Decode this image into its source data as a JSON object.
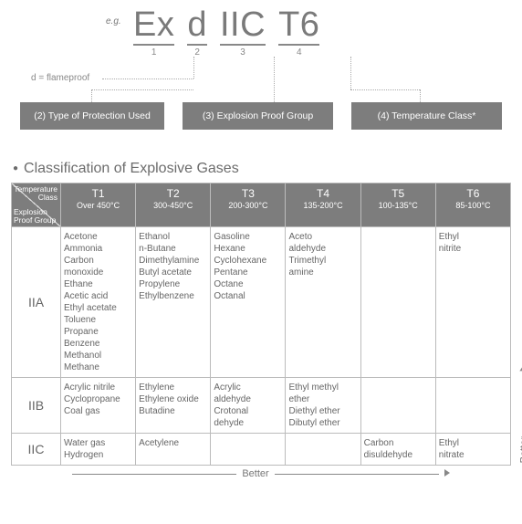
{
  "header": {
    "eg": "e.g.",
    "segments": [
      {
        "text": "Ex",
        "num": "1"
      },
      {
        "text": "d",
        "num": "2"
      },
      {
        "text": "IIC",
        "num": "3"
      },
      {
        "text": "T6",
        "num": "4"
      }
    ],
    "flameproof": "d = flameproof",
    "boxes": [
      "(2) Type of Protection Used",
      "(3) Explosion Proof Group",
      "(4) Temperature Class*"
    ]
  },
  "section_title": "Classification of Explosive Gases",
  "table": {
    "diag": {
      "top": "Temperature\nClass",
      "bottom": "Explosion\nProof  Group"
    },
    "columns": [
      {
        "code": "T1",
        "range": "Over 450°C"
      },
      {
        "code": "T2",
        "range": "300-450°C"
      },
      {
        "code": "T3",
        "range": "200-300°C"
      },
      {
        "code": "T4",
        "range": "135-200°C"
      },
      {
        "code": "T5",
        "range": "100-135°C"
      },
      {
        "code": "T6",
        "range": "85-100°C"
      }
    ],
    "rows": [
      {
        "group": "IIA",
        "cells": [
          "Acetone\nAmmonia\nCarbon\n   monoxide\nEthane\nAcetic acid\nEthyl acetate\nToluene\nPropane\nBenzene\nMethanol\nMethane",
          "Ethanol\nn-Butane\nDimethylamine\nButyl acetate\nPropylene\nEthylbenzene",
          "Gasoline\nHexane\nCyclohexane\nPentane\nOctane\nOctanal",
          "Aceto\n  aldehyde\nTrimethyl\n  amine",
          "",
          "Ethyl\n  nitrite"
        ]
      },
      {
        "group": "IIB",
        "cells": [
          "Acrylic nitrile\nCyclopropane\nCoal gas",
          "Ethylene\nEthylene oxide\nButadine",
          "Acrylic\n  aldehyde\nCrotonal\n  dehyde",
          "Ethyl methyl\n  ether\nDiethyl ether\nDibutyl ether",
          "",
          ""
        ]
      },
      {
        "group": "IIC",
        "cells": [
          "Water gas\nHydrogen",
          "Acetylene",
          "",
          "",
          "Carbon\n  disuldehyde",
          "Ethyl\n  nitrate"
        ]
      }
    ]
  },
  "better": "Better"
}
